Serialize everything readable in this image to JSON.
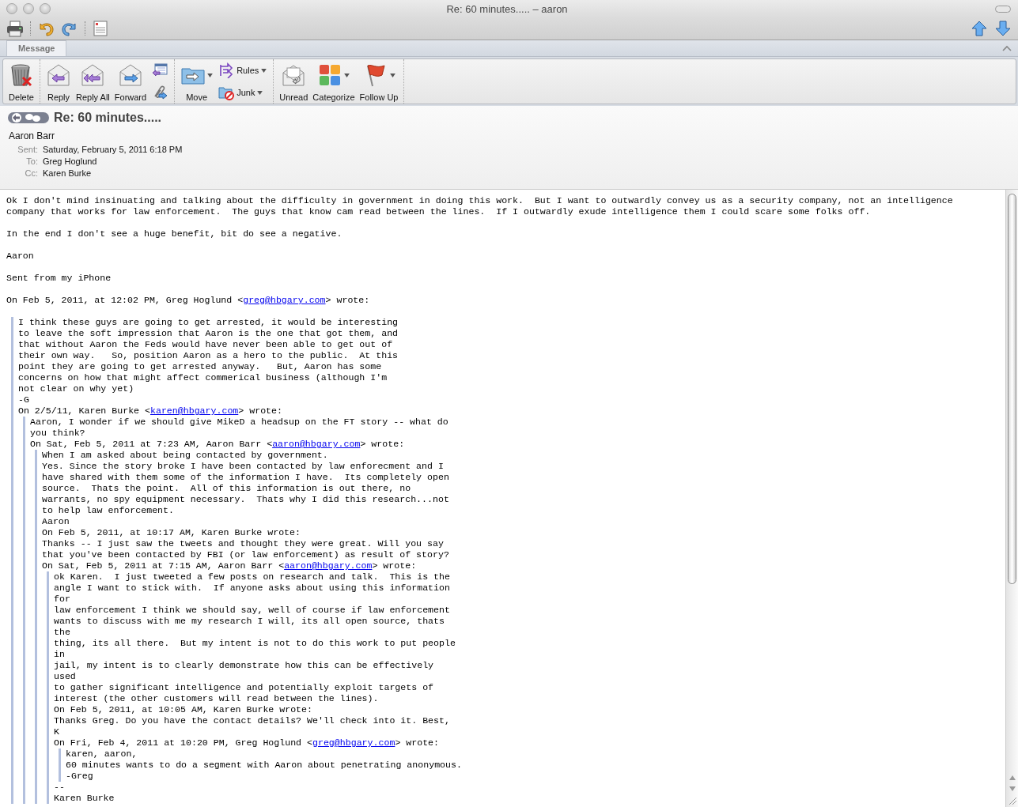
{
  "window": {
    "title": "Re: 60 minutes..... – aaron"
  },
  "tabs": [
    {
      "label": "Message",
      "selected": true
    }
  ],
  "ribbon": {
    "groups": [
      [
        {
          "kind": "large",
          "label": "Delete",
          "dropdown": false
        }
      ],
      [
        {
          "kind": "large",
          "label": "Reply",
          "dropdown": false
        },
        {
          "kind": "large",
          "label": "Reply All",
          "dropdown": false
        },
        {
          "kind": "large",
          "label": "Forward",
          "dropdown": false
        },
        {
          "kind": "stack",
          "items": [
            {
              "dropdown": false
            },
            {
              "dropdown": false
            }
          ]
        }
      ],
      [
        {
          "kind": "large",
          "label": "Move",
          "dropdown": true
        },
        {
          "kind": "stack",
          "items": [
            {
              "label": "Rules",
              "dropdown": true
            },
            {
              "label": "Junk",
              "dropdown": true
            }
          ]
        }
      ],
      [
        {
          "kind": "large",
          "label": "Unread",
          "dropdown": false
        },
        {
          "kind": "large",
          "label": "Categorize",
          "dropdown": true
        },
        {
          "kind": "large",
          "label": "Follow Up",
          "dropdown": true
        }
      ]
    ]
  },
  "message": {
    "subject": "Re: 60 minutes.....",
    "from": "Aaron Barr",
    "fields": [
      {
        "label": "Sent:",
        "value": "Saturday, February 5, 2011 6:18 PM"
      },
      {
        "label": "To:",
        "value": "Greg Hoglund"
      },
      {
        "label": "Cc:",
        "value": "Karen Burke"
      }
    ]
  },
  "body": [
    {
      "kind": "para",
      "text": "Ok I don't mind insinuating and talking about the difficulty in government in doing this work.  But I want to outwardly convey us as a security company, not an intelligence company that works for law enforcement.  The guys that know cam read between the lines.  If I outwardly exude intelligence them I could scare some folks off."
    },
    {
      "kind": "para",
      "text": "In the end I don't see a huge benefit, bit do see a negative."
    },
    {
      "kind": "para",
      "text": "Aaron"
    },
    {
      "kind": "para",
      "text": "Sent from my iPhone"
    },
    {
      "kind": "para",
      "text": "On Feb 5, 2011, at 12:02 PM, Greg Hoglund <",
      "link": "greg@hbgary.com",
      "after": "> wrote:"
    },
    {
      "kind": "quote",
      "children": [
        {
          "kind": "line",
          "text": "I think these guys are going to get arrested, it would be interesting"
        },
        {
          "kind": "line",
          "text": "to leave the soft impression that Aaron is the one that got them, and"
        },
        {
          "kind": "line",
          "text": "that without Aaron the Feds would have never been able to get out of"
        },
        {
          "kind": "line",
          "text": "their own way.   So, position Aaron as a hero to the public.  At this"
        },
        {
          "kind": "line",
          "text": "point they are going to get arrested anyway.   But, Aaron has some"
        },
        {
          "kind": "line",
          "text": "concerns on how that might affect commerical business (although I'm"
        },
        {
          "kind": "line",
          "text": "not clear on why yet)"
        },
        {
          "kind": "line",
          "text": "-G"
        },
        {
          "kind": "line",
          "text": "On 2/5/11, Karen Burke <",
          "link": "karen@hbgary.com",
          "after": "> wrote:"
        },
        {
          "kind": "quote",
          "children": [
            {
              "kind": "line",
              "text": "Aaron, I wonder if we should give MikeD a headsup on the FT story -- what do"
            },
            {
              "kind": "line",
              "text": "you think?"
            },
            {
              "kind": "line",
              "text": "On Sat, Feb 5, 2011 at 7:23 AM, Aaron Barr <",
              "link": "aaron@hbgary.com",
              "after": "> wrote:"
            },
            {
              "kind": "quote",
              "children": [
                {
                  "kind": "line",
                  "text": "When I am asked about being contacted by government."
                },
                {
                  "kind": "line",
                  "text": "Yes. Since the story broke I have been contacted by law enforecment and I"
                },
                {
                  "kind": "line",
                  "text": "have shared with them some of the information I have.  Its completely open"
                },
                {
                  "kind": "line",
                  "text": "source.  Thats the point.  All of this information is out there, no"
                },
                {
                  "kind": "line",
                  "text": "warrants, no spy equipment necessary.  Thats why I did this research...not"
                },
                {
                  "kind": "line",
                  "text": "to help law enforcement."
                },
                {
                  "kind": "line",
                  "text": "Aaron"
                },
                {
                  "kind": "line",
                  "text": "On Feb 5, 2011, at 10:17 AM, Karen Burke wrote:"
                },
                {
                  "kind": "line",
                  "text": "Thanks -- I just saw the tweets and thought they were great. Will you say"
                },
                {
                  "kind": "line",
                  "text": "that you've been contacted by FBI (or law enforcement) as result of story?"
                },
                {
                  "kind": "line",
                  "text": "On Sat, Feb 5, 2011 at 7:15 AM, Aaron Barr <",
                  "link": "aaron@hbgary.com",
                  "after": "> wrote:"
                },
                {
                  "kind": "quote",
                  "children": [
                    {
                      "kind": "line",
                      "text": "ok Karen.  I just tweeted a few posts on research and talk.  This is the"
                    },
                    {
                      "kind": "line",
                      "text": "angle I want to stick with.  If anyone asks about using this information"
                    },
                    {
                      "kind": "line",
                      "text": "for"
                    },
                    {
                      "kind": "line",
                      "text": "law enforcement I think we should say, well of course if law enforcement"
                    },
                    {
                      "kind": "line",
                      "text": "wants to discuss with me my research I will, its all open source, thats"
                    },
                    {
                      "kind": "line",
                      "text": "the"
                    },
                    {
                      "kind": "line",
                      "text": "thing, its all there.  But my intent is not to do this work to put people"
                    },
                    {
                      "kind": "line",
                      "text": "in"
                    },
                    {
                      "kind": "line",
                      "text": "jail, my intent is to clearly demonstrate how this can be effectively"
                    },
                    {
                      "kind": "line",
                      "text": "used"
                    },
                    {
                      "kind": "line",
                      "text": "to gather significant intelligence and potentially exploit targets of"
                    },
                    {
                      "kind": "line",
                      "text": "interest (the other customers will read between the lines)."
                    },
                    {
                      "kind": "line",
                      "text": "On Feb 5, 2011, at 10:05 AM, Karen Burke wrote:"
                    },
                    {
                      "kind": "line",
                      "text": "Thanks Greg. Do you have the contact details? We'll check into it. Best,"
                    },
                    {
                      "kind": "line",
                      "text": "K"
                    },
                    {
                      "kind": "line",
                      "text": "On Fri, Feb 4, 2011 at 10:20 PM, Greg Hoglund <",
                      "link": "greg@hbgary.com",
                      "after": "> wrote:"
                    },
                    {
                      "kind": "quote",
                      "children": [
                        {
                          "kind": "line",
                          "text": "karen, aaron,"
                        },
                        {
                          "kind": "line",
                          "text": "60 minutes wants to do a segment with Aaron about penetrating anonymous."
                        },
                        {
                          "kind": "line",
                          "text": "-Greg"
                        }
                      ]
                    },
                    {
                      "kind": "line",
                      "text": "--"
                    },
                    {
                      "kind": "line",
                      "text": "Karen Burke"
                    }
                  ]
                }
              ]
            }
          ]
        }
      ]
    }
  ]
}
